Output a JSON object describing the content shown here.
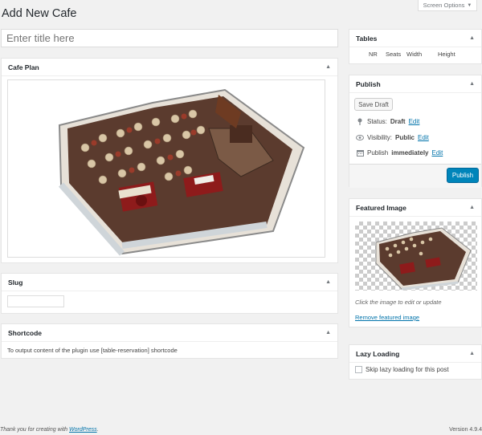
{
  "page": {
    "heading": "Add New Cafe",
    "screen_options": "Screen Options",
    "title_placeholder": "Enter title here"
  },
  "cafe_plan": {
    "title": "Cafe Plan"
  },
  "slug": {
    "title": "Slug",
    "value": ""
  },
  "shortcode": {
    "title": "Shortcode",
    "text": "To output content of the plugin use [table-reservation] shortcode"
  },
  "tables": {
    "title": "Tables",
    "columns": [
      "NR",
      "Seats",
      "Width",
      "Height"
    ]
  },
  "publish": {
    "title": "Publish",
    "save_draft": "Save Draft",
    "status_label": "Status:",
    "status_value": "Draft",
    "status_edit": "Edit",
    "visibility_label": "Visibility:",
    "visibility_value": "Public",
    "visibility_edit": "Edit",
    "publish_label": "Publish",
    "publish_value": "immediately",
    "publish_edit": "Edit",
    "publish_button": "Publish"
  },
  "featured_image": {
    "title": "Featured Image",
    "hint": "Click the image to edit or update",
    "remove_link": "Remove featured image"
  },
  "lazy_loading": {
    "title": "Lazy Loading",
    "checkbox_label": "Skip lazy loading for this post",
    "checked": false
  },
  "footer": {
    "thanks_prefix": "Thank you for creating with",
    "thanks_link": "WordPress",
    "thanks_suffix": ".",
    "version": "Version 4.9.4"
  },
  "icons": {
    "status": "pin-icon",
    "visibility": "eye-icon",
    "schedule": "calendar-icon",
    "toggle": "caret-up-icon",
    "screen_options": "caret-down-icon"
  },
  "colors": {
    "primary_button": "#0085ba",
    "link": "#0073aa",
    "background": "#f1f1f1"
  }
}
